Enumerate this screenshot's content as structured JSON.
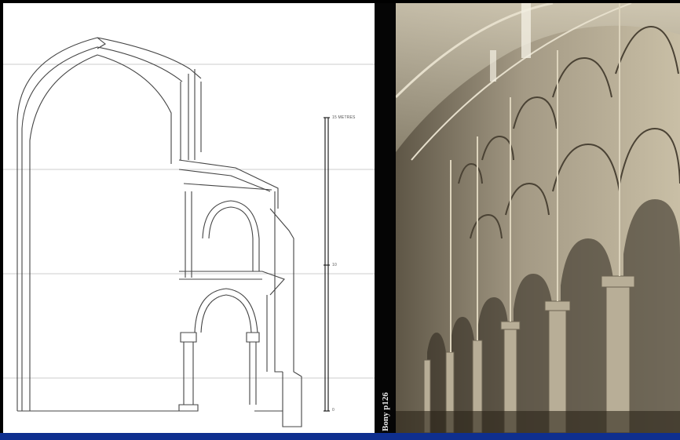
{
  "slide": {
    "left_panel": {
      "scale_labels": [
        "15 METRES",
        "10",
        "0"
      ]
    },
    "caption": "Bony p126",
    "colors": {
      "frame": "#000000",
      "bottom_bar": "#0f2f8f",
      "drawing_line": "#444444",
      "paper": "#ffffff"
    }
  }
}
